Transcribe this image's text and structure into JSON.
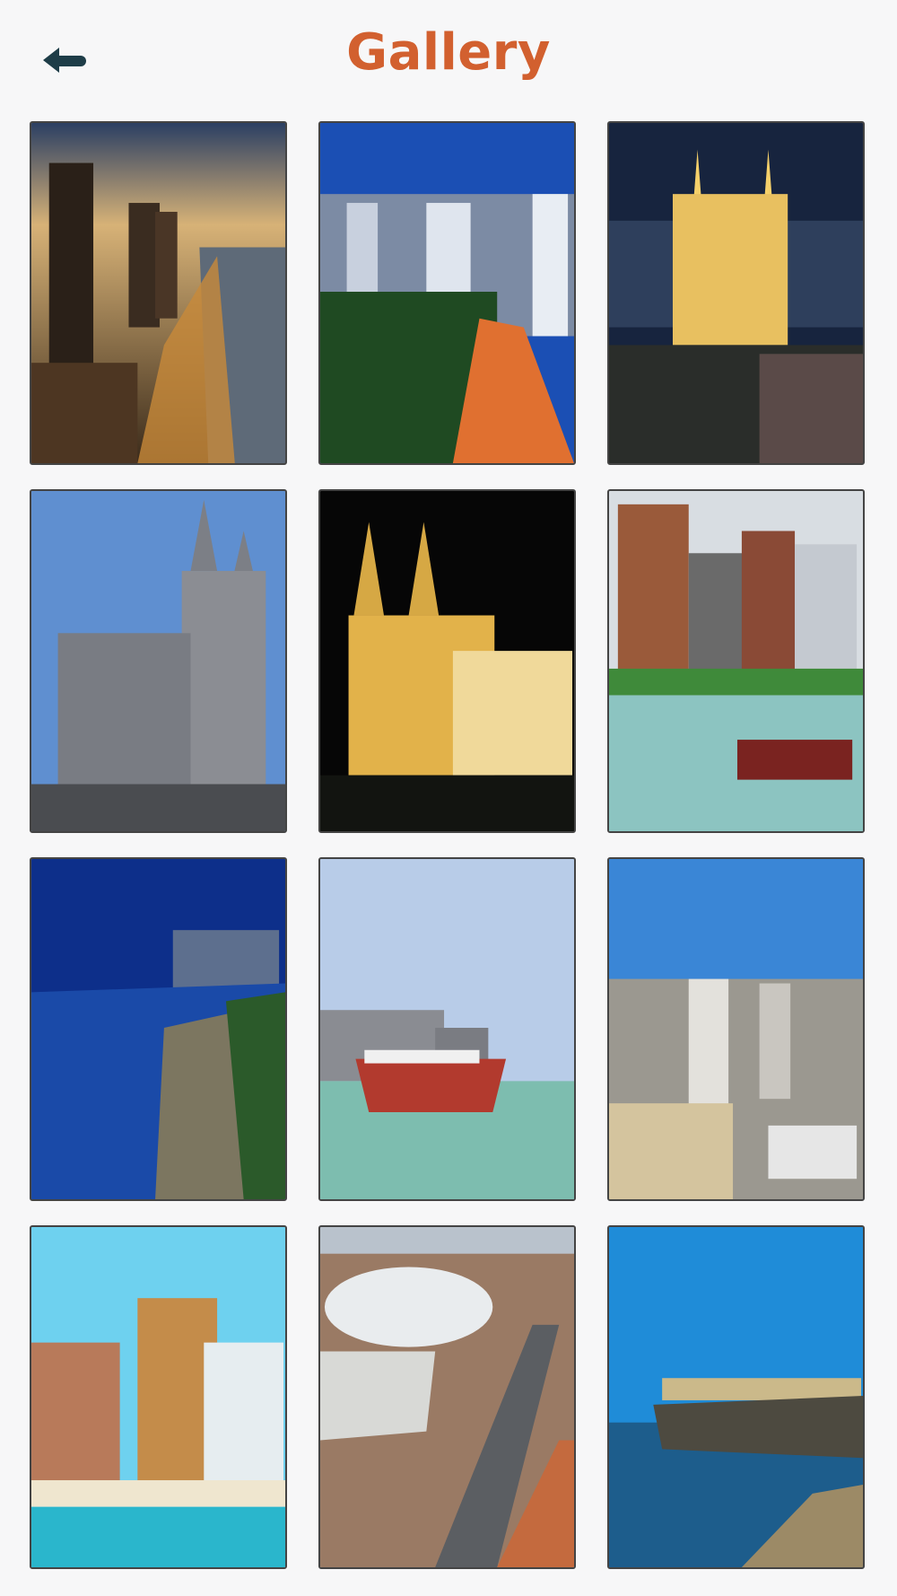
{
  "header": {
    "title": "Gallery",
    "back_icon": "arrow-left-icon"
  },
  "colors": {
    "title": "#d2602f",
    "back_icon": "#1e3d48",
    "background": "#f7f7f8",
    "tile_border": "#444444"
  },
  "gallery": {
    "photos": [
      {
        "subject": "beach-avenue-sunset"
      },
      {
        "subject": "city-skyline-night-blue"
      },
      {
        "subject": "cathedral-night-aerial"
      },
      {
        "subject": "cathedral-day"
      },
      {
        "subject": "cathedral-lit-night"
      },
      {
        "subject": "harbor-boats-towers"
      },
      {
        "subject": "bay-beach-night"
      },
      {
        "subject": "boat-water-skyline"
      },
      {
        "subject": "city-aerial-day"
      },
      {
        "subject": "beach-hotels"
      },
      {
        "subject": "stadium-highway"
      },
      {
        "subject": "fortress-cliff-sea"
      }
    ]
  }
}
